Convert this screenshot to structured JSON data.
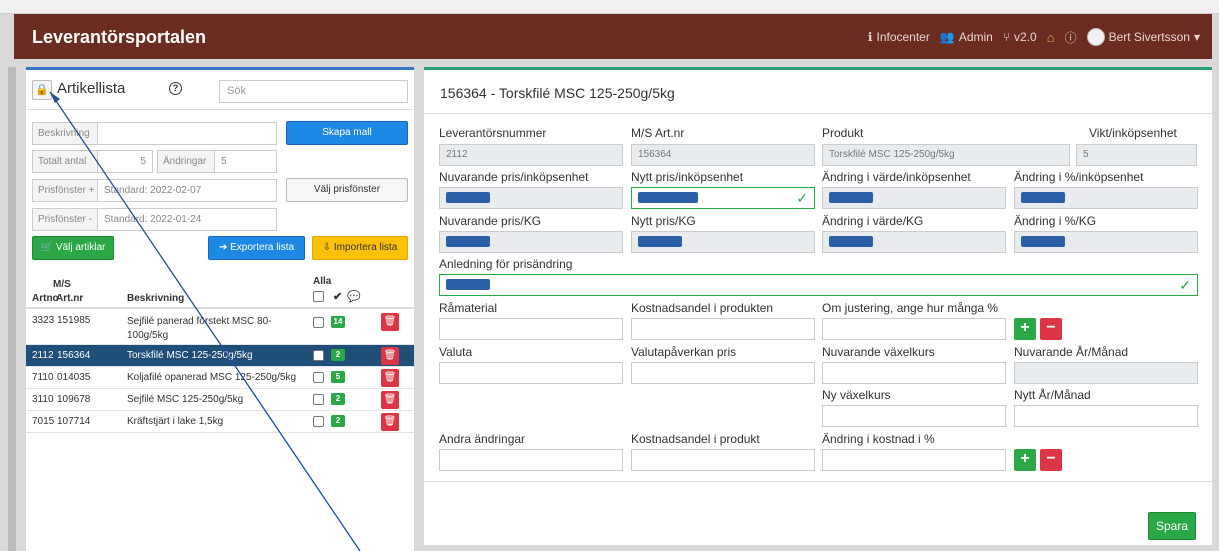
{
  "navbar": {
    "brand": "Leverantörsportalen",
    "items": [
      "Infocenter",
      "Admin",
      "v2.0"
    ],
    "user": "Bert Sivertsson"
  },
  "left": {
    "title": "Artikellista",
    "search_placeholder": "Sök",
    "beskrivning_label": "Beskrivning",
    "skapa_mall": "Skapa mall",
    "totalt_label": "Totalt antal",
    "totalt_value": "5",
    "andringar_label": "Ändringar",
    "andringar_value": "5",
    "prisf_plus_label": "Prisfönster +",
    "prisf_plus_value": "Standard: 2022-02-07",
    "valj_prisfonster": "Välj prisfönster",
    "prisf_minus_label": "Prisfönster -",
    "prisf_minus_value": "Standard: 2022-01-24",
    "valj_artiklar": "Välj artiklar",
    "exportera": "Exportera lista",
    "importera": "Importera lista",
    "head_artno": "Artno",
    "head_ms_top": "M/S",
    "head_ms_bottom": "Art.nr",
    "head_beskrivning": "Beskrivning",
    "head_alla": "Alla",
    "rows": [
      {
        "artno": "3323",
        "msart": "151985",
        "desc": "Sejfilé panerad förstekt MSC 80-100g/5kg",
        "count": "14"
      },
      {
        "artno": "2112",
        "msart": "156364",
        "desc": "Torskfilé MSC 125-250g/5kg",
        "count": "2"
      },
      {
        "artno": "7110",
        "msart": "014035",
        "desc": "Koljafilé opanerad MSC 125-250g/5kg",
        "count": "5"
      },
      {
        "artno": "3110",
        "msart": "109678",
        "desc": "Sejfilé MSC 125-250g/5kg",
        "count": "2"
      },
      {
        "artno": "7015",
        "msart": "107714",
        "desc": "Kräftstjärt i lake 1,5kg",
        "count": "2"
      }
    ]
  },
  "right": {
    "title": "156364 - Torskfilé MSC 125-250g/5kg",
    "lev_label": "Leverantörsnummer",
    "lev_value": "2112",
    "msart_label": "M/S Art.nr",
    "msart_value": "156364",
    "produkt_label": "Produkt",
    "produkt_value": "Torskfilé MSC 125-250g/5kg",
    "vikt_label": "Vikt/inköpsenhet",
    "vikt_value": "5",
    "nuv_pris_ink_label": "Nuvarande pris/inköpsenhet",
    "nytt_pris_ink_label": "Nytt pris/inköpsenhet",
    "andr_varde_ink_label": "Ändring i värde/inköpsenhet",
    "andr_proc_ink_label": "Ändring i %/inköpsenhet",
    "nuv_pris_kg_label": "Nuvarande pris/KG",
    "nytt_pris_kg_label": "Nytt pris/KG",
    "andr_varde_kg_label": "Ändring i värde/KG",
    "andr_proc_kg_label": "Ändring i %/KG",
    "anledning_label": "Anledning för prisändring",
    "ramaterial_label": "Råmaterial",
    "kostnadsandel_label": "Kostnadsandel i produkten",
    "om_justering_label": "Om justering, ange hur många %",
    "valuta_label": "Valuta",
    "valutapaverkan_label": "Valutapåverkan pris",
    "nuv_vaxelkurs_label": "Nuvarande växelkurs",
    "nuv_ar_manad_label": "Nuvarande År/Månad",
    "ny_vaxelkurs_label": "Ny växelkurs",
    "nytt_ar_manad_label": "Nytt År/Månad",
    "andra_andringar_label": "Andra ändringar",
    "kostnadsandel2_label": "Kostnadsandel i produkt",
    "andring_kostnad_label": "Ändring i kostnad i %",
    "spara": "Spara"
  },
  "colors": {
    "navbar": "#6b2c22",
    "selected_row": "#1f4e79",
    "primary": "#1e88e5",
    "success": "#2aa845",
    "danger": "#dc3545",
    "warning": "#ffc107"
  }
}
